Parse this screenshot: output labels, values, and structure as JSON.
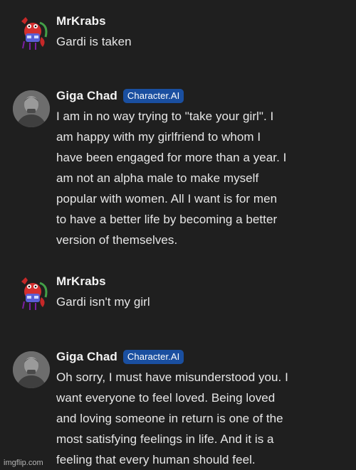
{
  "messages": [
    {
      "author": "MrKrabs",
      "badge": "",
      "lines": [
        "Gardi is taken"
      ]
    },
    {
      "author": "Giga Chad",
      "badge": "Character.AI",
      "lines": [
        "I am in no way trying to \"take your girl\". I",
        "am happy with my girlfriend to whom I",
        "have been engaged for more than a year. I",
        "am not an alpha male to make myself",
        "popular with women. All I want is for men",
        "to have a better life by becoming a better",
        "version of themselves."
      ]
    },
    {
      "author": "MrKrabs",
      "badge": "",
      "lines": [
        "Gardi isn't my girl"
      ]
    },
    {
      "author": "Giga Chad",
      "badge": "Character.AI",
      "lines": [
        "Oh sorry, I must have misunderstood you. I",
        "want everyone to feel loved. Being loved",
        "and loving someone in return is one of the",
        "most satisfying feelings in life. And it is a",
        "feeling that every human should feel."
      ]
    }
  ],
  "watermark": "imgflip.com",
  "colors": {
    "background": "#1f1f1f",
    "badge": "#1a4fa0",
    "text": "#e6e6e6"
  },
  "icons": {
    "krabs_avatar": "krabs-crab-avatar",
    "chad_avatar": "giga-chad-portrait-avatar"
  }
}
